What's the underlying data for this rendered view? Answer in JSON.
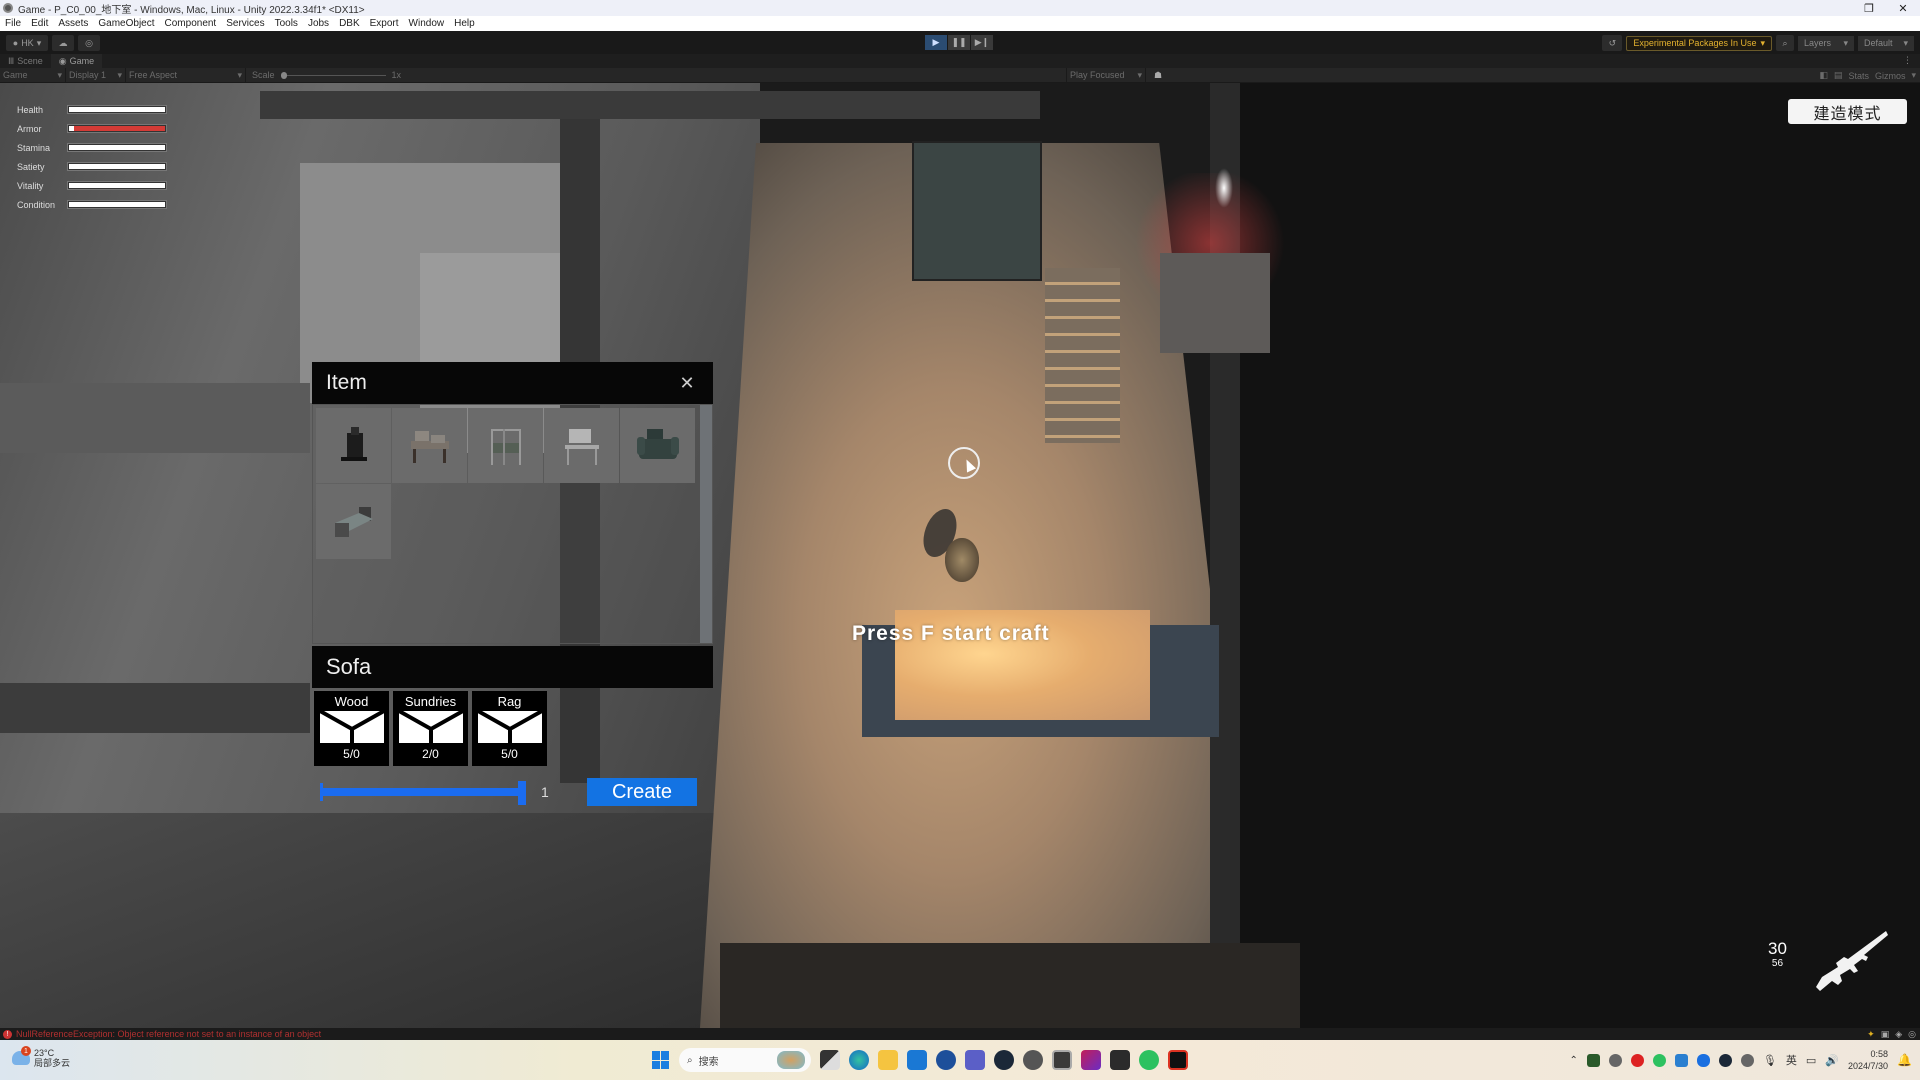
{
  "window": {
    "title": "Game - P_C0_00_地下室 - Windows, Mac, Linux - Unity 2022.3.34f1* <DX11>",
    "restore_icon": "restore-icon",
    "close_icon": "close-icon"
  },
  "menu": {
    "items": [
      "File",
      "Edit",
      "Assets",
      "GameObject",
      "Component",
      "Services",
      "Tools",
      "Jobs",
      "DBK",
      "Export",
      "Window",
      "Help"
    ]
  },
  "toolbar": {
    "account_label": "HK",
    "play_icon": "play-icon",
    "pause_icon": "pause-icon",
    "step_icon": "step-icon",
    "experimental_label": "Experimental Packages In Use",
    "layers_label": "Layers",
    "layout_label": "Default"
  },
  "tabs": [
    {
      "label": "Scene",
      "icon": "scene-icon"
    },
    {
      "label": "Game",
      "icon": "gamepad-icon",
      "active": true
    }
  ],
  "game_toolbar": {
    "mode": "Game",
    "display": "Display 1",
    "aspect": "Free Aspect",
    "scale_label": "Scale",
    "scale_value": "1x",
    "play_mode": "Play Focused",
    "stats_label": "Stats",
    "gizmos_label": "Gizmos"
  },
  "hud": {
    "stats": [
      {
        "label": "Health",
        "value": 1.0
      },
      {
        "label": "Armor",
        "value": 1.0,
        "color": "#d43b36"
      },
      {
        "label": "Stamina",
        "value": 1.0
      },
      {
        "label": "Satiety",
        "value": 1.0
      },
      {
        "label": "Vitality",
        "value": 1.0
      },
      {
        "label": "Condition",
        "value": 1.0
      }
    ],
    "build_mode_label": "建造模式",
    "craft_prompt": "Press F start craft",
    "ammo": {
      "magazine": "30",
      "reserve": "56",
      "weapon_icon": "rifle-icon"
    }
  },
  "craft_panel": {
    "title": "Item",
    "close_icon": "close-icon",
    "items": [
      {
        "name": "stove",
        "icon": "stove-icon"
      },
      {
        "name": "workbench",
        "icon": "workbench-icon"
      },
      {
        "name": "planter-shelf",
        "icon": "planter-shelf-icon"
      },
      {
        "name": "desk-shelf",
        "icon": "desk-shelf-icon"
      },
      {
        "name": "sofa",
        "icon": "sofa-icon"
      },
      {
        "name": "bed",
        "icon": "bed-icon"
      }
    ],
    "selected_item": "Sofa",
    "materials": [
      {
        "name": "Wood",
        "count": "5/0"
      },
      {
        "name": "Sundries",
        "count": "2/0"
      },
      {
        "name": "Rag",
        "count": "5/0"
      }
    ],
    "quantity": "1",
    "quantity_fraction": 1.0,
    "accent_color": "#1373e3",
    "create_label": "Create"
  },
  "console": {
    "error": "NullReferenceException: Object reference not set to an instance of an object"
  },
  "taskbar": {
    "weather_temp": "23°C",
    "weather_desc": "局部多云",
    "weather_badge": "1",
    "search_placeholder": "搜索",
    "apps": [
      "task-view",
      "edge",
      "file-explorer",
      "mail",
      "vpn",
      "teams",
      "steam",
      "unity-hub",
      "unity",
      "rider",
      "terminal",
      "wechat",
      "capture"
    ],
    "time": "0:58",
    "date": "2024/7/30",
    "ime_label": "英"
  }
}
